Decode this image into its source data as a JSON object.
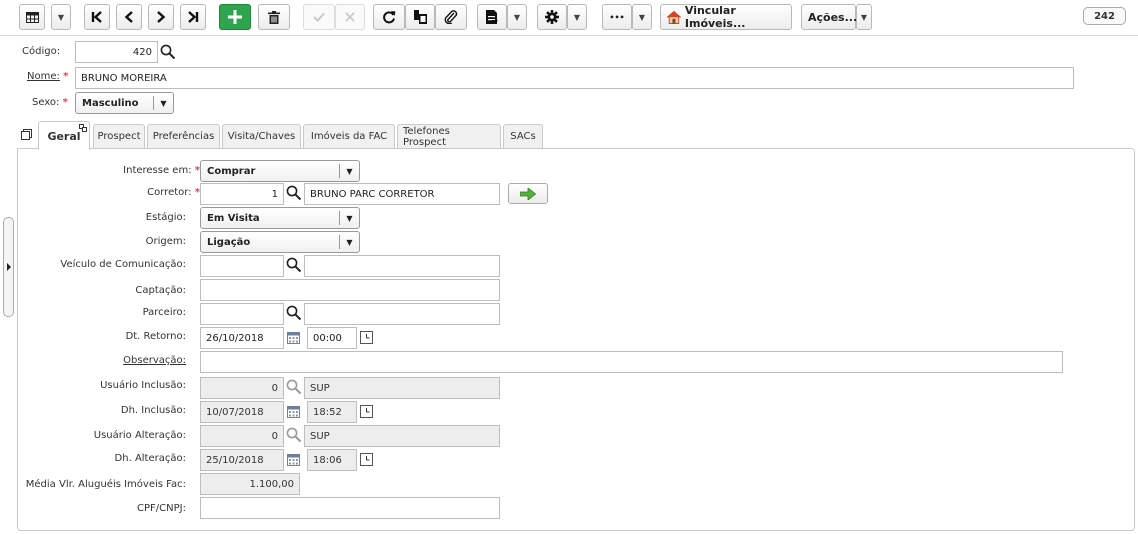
{
  "toolbar": {
    "actions_label": "Ações...",
    "link_label": "Vincular Imóveis...",
    "more_label": "•••",
    "record_count": "242",
    "icons": [
      "grid-icon",
      "first-record-icon",
      "prev-record-icon",
      "next-record-icon",
      "last-record-icon",
      "add-icon",
      "delete-icon",
      "confirm-icon",
      "cancel-icon",
      "refresh-icon",
      "copy-icon",
      "attach-icon",
      "report-icon",
      "gear-icon",
      "house-icon"
    ]
  },
  "header": {
    "codigo_label": "Código:",
    "codigo_value": "420",
    "nome_label": "Nome:",
    "nome_value": "BRUNO MOREIRA",
    "sexo_label": "Sexo:",
    "sexo_value": "Masculino",
    "required_mark": "*"
  },
  "tabs": [
    {
      "label": "Geral",
      "active": true
    },
    {
      "label": "Prospect"
    },
    {
      "label": "Preferências"
    },
    {
      "label": "Visita/Chaves"
    },
    {
      "label": "Imóveis da FAC"
    },
    {
      "label": "Telefones Prospect"
    },
    {
      "label": "SACs"
    }
  ],
  "form": {
    "interesse": {
      "label": "Interesse em:",
      "value": "Comprar"
    },
    "corretor": {
      "label": "Corretor:",
      "code": "1",
      "name": "BRUNO PARC CORRETOR"
    },
    "estagio": {
      "label": "Estágio:",
      "value": "Em Visita"
    },
    "origem": {
      "label": "Origem:",
      "value": "Ligação"
    },
    "veiculo": {
      "label": "Veículo de Comunicação:",
      "code": "",
      "name": ""
    },
    "captacao": {
      "label": "Captação:",
      "value": ""
    },
    "parceiro": {
      "label": "Parceiro:",
      "code": "",
      "name": ""
    },
    "dt_retorno": {
      "label": "Dt. Retorno:",
      "date": "26/10/2018",
      "time": "00:00"
    },
    "observacao": {
      "label": "Observação:",
      "value": ""
    },
    "usuario_inclusao": {
      "label": "Usuário Inclusão:",
      "code": "0",
      "name": "SUP"
    },
    "dh_inclusao": {
      "label": "Dh. Inclusão:",
      "date": "10/07/2018",
      "time": "18:52"
    },
    "usuario_alteracao": {
      "label": "Usuário Alteração:",
      "code": "0",
      "name": "SUP"
    },
    "dh_alteracao": {
      "label": "Dh. Alteração:",
      "date": "25/10/2018",
      "time": "18:06"
    },
    "media_alugueis": {
      "label": "Média Vlr. Aluguéis Imóveis Fac:",
      "value": "1.100,00"
    },
    "cpf_cnpj": {
      "label": "CPF/CNPJ:",
      "value": ""
    }
  },
  "colors": {
    "add_button": "#2ea44f",
    "required": "#e14444",
    "readonly_bg": "#ededed"
  }
}
